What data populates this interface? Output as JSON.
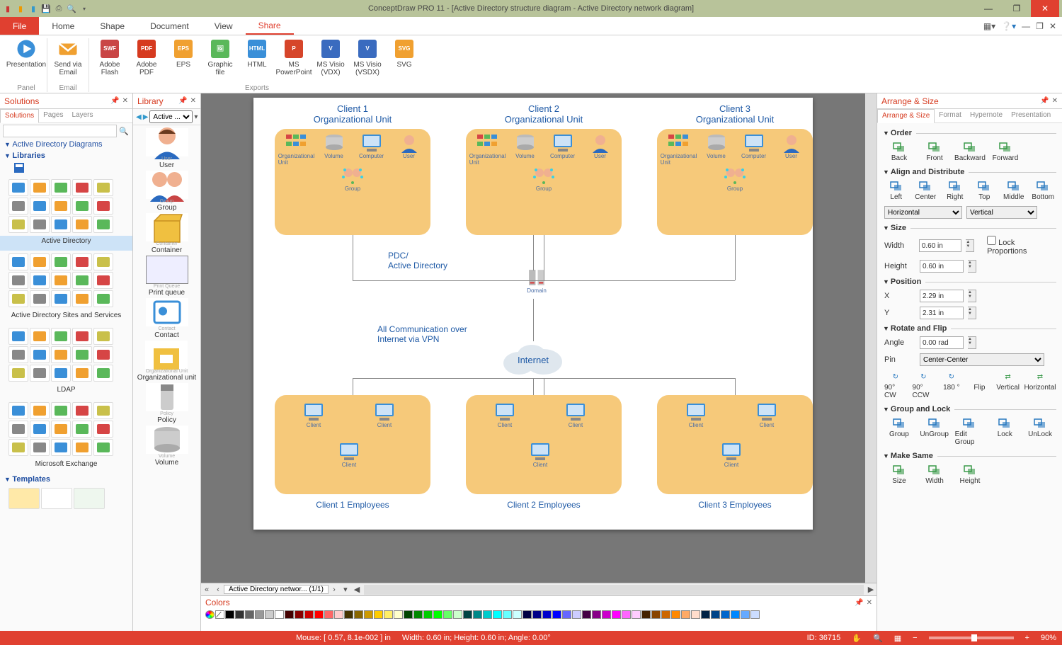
{
  "app": {
    "title": "ConceptDraw PRO 11 - [Active Directory structure diagram - Active Directory network diagram]"
  },
  "qat_icons": [
    "red",
    "orange",
    "blue",
    "sep",
    "save",
    "sep",
    "undo",
    "search",
    "dropdown"
  ],
  "window_buttons": {
    "min": "▬",
    "max": "▢",
    "close": "✕"
  },
  "menu": {
    "file": "File",
    "tabs": [
      "Home",
      "Shape",
      "Document",
      "View",
      "Share"
    ],
    "active": "Share"
  },
  "ribbon": {
    "groups": [
      {
        "label": "Panel",
        "items": [
          {
            "label": "Presentation",
            "icon": "play"
          }
        ]
      },
      {
        "label": "Email",
        "items": [
          {
            "label": "Send via Email",
            "icon": "mail"
          }
        ]
      },
      {
        "label": "Exports",
        "items": [
          {
            "label": "Adobe Flash",
            "icon": "swf"
          },
          {
            "label": "Adobe PDF",
            "icon": "pdf"
          },
          {
            "label": "EPS",
            "icon": "eps"
          },
          {
            "label": "Graphic file",
            "icon": "img"
          },
          {
            "label": "HTML",
            "icon": "html"
          },
          {
            "label": "MS PowerPoint",
            "icon": "ppt"
          },
          {
            "label": "MS Visio (VDX)",
            "icon": "vdx"
          },
          {
            "label": "MS Visio (VSDX)",
            "icon": "vsdx"
          },
          {
            "label": "SVG",
            "icon": "svg"
          }
        ]
      }
    ]
  },
  "solutions": {
    "title": "Solutions",
    "tabs": [
      "Solutions",
      "Pages",
      "Layers"
    ],
    "search_placeholder": "",
    "tree": {
      "group": "Active Directory Diagrams",
      "libs_head": "Libraries",
      "stencils": [
        {
          "label": "Active Directory"
        },
        {
          "label": "Active Directory Sites and Services"
        },
        {
          "label": "LDAP"
        },
        {
          "label": "Microsoft Exchange"
        }
      ],
      "templates_head": "Templates"
    }
  },
  "library": {
    "title": "Library",
    "dropdown": "Active ...",
    "items": [
      {
        "sub": "User",
        "label": "User"
      },
      {
        "sub": "Group",
        "label": "Group"
      },
      {
        "sub": "Container",
        "label": "Container"
      },
      {
        "sub": "Print Queue",
        "label": "Print queue"
      },
      {
        "sub": "Contact",
        "label": "Contact"
      },
      {
        "sub": "Organizational Unit",
        "label": "Organizational unit"
      },
      {
        "sub": "Policy",
        "label": "Policy"
      },
      {
        "sub": "Volume",
        "label": "Volume"
      }
    ]
  },
  "diagram": {
    "clients": [
      {
        "title1": "Client 1",
        "title2": "Organizational Unit"
      },
      {
        "title1": "Client 2",
        "title2": "Organizational Unit"
      },
      {
        "title1": "Client 3",
        "title2": "Organizational Unit"
      }
    ],
    "ou_icons": {
      "org": "Organizational Unit",
      "vol": "Volume",
      "comp": "Computer",
      "user": "User",
      "group": "Group"
    },
    "pdc": "PDC/\nActive Directory",
    "domain": "Domain",
    "vpn": "All Communication over\nInternet via VPN",
    "internet": "Internet",
    "client_label": "Client",
    "emp": [
      "Client 1 Employees",
      "Client 2 Employees",
      "Client 3 Employees"
    ]
  },
  "doc_tab": "Active Directory networ...  (1/1)",
  "colors_panel": {
    "title": "Colors"
  },
  "arrange": {
    "title": "Arrange & Size",
    "tabs": [
      "Arrange & Size",
      "Format",
      "Hypernote",
      "Presentation"
    ],
    "sections": {
      "order": {
        "head": "Order",
        "btns": [
          "Back",
          "Front",
          "Backward",
          "Forward"
        ]
      },
      "align": {
        "head": "Align and Distribute",
        "btns": [
          "Left",
          "Center",
          "Right",
          "Top",
          "Middle",
          "Bottom"
        ],
        "horiz": "Horizontal",
        "vert": "Vertical"
      },
      "size": {
        "head": "Size",
        "width": "Width",
        "height": "Height",
        "wval": "0.60 in",
        "hval": "0.60 in",
        "lock": "Lock Proportions"
      },
      "pos": {
        "head": "Position",
        "x": "X",
        "y": "Y",
        "xval": "2.29 in",
        "yval": "2.31 in"
      },
      "rotate": {
        "head": "Rotate and Flip",
        "angle": "Angle",
        "aval": "0.00 rad",
        "pin": "Pin",
        "pinval": "Center-Center",
        "btns1": [
          "90° CW",
          "90° CCW",
          "180 °"
        ],
        "flip": "Flip",
        "btns2": [
          "Vertical",
          "Horizontal"
        ]
      },
      "group": {
        "head": "Group and Lock",
        "btns": [
          "Group",
          "UnGroup",
          "Edit Group",
          "Lock",
          "UnLock"
        ]
      },
      "same": {
        "head": "Make Same",
        "btns": [
          "Size",
          "Width",
          "Height"
        ]
      }
    }
  },
  "status": {
    "mouse": "Mouse: [ 0.57, 8.1e-002 ] in",
    "dims": "Width: 0.60 in;  Height: 0.60 in;  Angle: 0.00°",
    "id": "ID: 36715",
    "zoom": "90%"
  },
  "color_swatches": [
    "#000",
    "#333",
    "#666",
    "#999",
    "#ccc",
    "#fff",
    "#400",
    "#800",
    "#c00",
    "#f00",
    "#f66",
    "#fcc",
    "#430",
    "#860",
    "#c90",
    "#fc0",
    "#fe6",
    "#ffc",
    "#040",
    "#080",
    "#0c0",
    "#0f0",
    "#6f6",
    "#cfc",
    "#044",
    "#088",
    "#0cc",
    "#0ff",
    "#6ff",
    "#cff",
    "#004",
    "#008",
    "#00c",
    "#00f",
    "#66f",
    "#ccf",
    "#404",
    "#808",
    "#c0c",
    "#f0f",
    "#f6f",
    "#fcf",
    "#420",
    "#840",
    "#c60",
    "#f80",
    "#fa6",
    "#fdc",
    "#024",
    "#048",
    "#06c",
    "#08f",
    "#6af",
    "#cdf"
  ]
}
